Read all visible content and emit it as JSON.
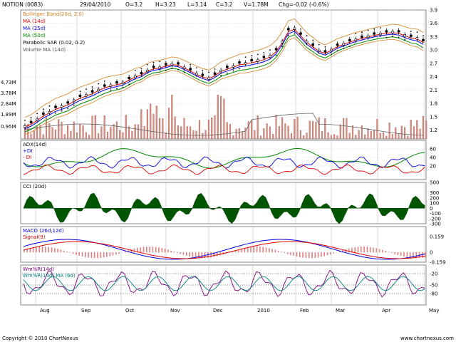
{
  "header": {
    "symbol": "NOTION (0083)",
    "date": "29/04/2010",
    "open": "O=3.2",
    "high": "H=3.23",
    "low": "L=3.14",
    "close": "C=3.2",
    "volume": "V=1.78M",
    "change": "Chg=-0.02 (-0.6%)"
  },
  "footer": {
    "copyright": "Copyright © 2010 ChartNexus",
    "site": "www.chartnexus.com"
  },
  "colors": {
    "up": "#000000",
    "bollinger": "#d08020",
    "ma14": "#dd0000",
    "ma25": "#0000dd",
    "ma50": "#008800",
    "sar": "#000000",
    "volume": "#888888",
    "grid": "#c0c0c0",
    "cci": "#005500"
  },
  "months": [
    "Aug",
    "Sep",
    "Oct",
    "Nov",
    "Dec",
    "2010",
    "Feb",
    "Mar",
    "Apr",
    "May"
  ],
  "chart_data": [
    {
      "type": "candlestick",
      "panel": "price",
      "legend": [
        "Bollinger Band(20d, 2.0)",
        "MA (14d)",
        "MA (25d)",
        "MA (50d)",
        "Parabolic SAR (0.02, 0.2)",
        "Volume MA (14d)"
      ],
      "price_ticks": [
        "3.9",
        "3.6",
        "3.3",
        "3.0",
        "2.7",
        "2.4",
        "2.1",
        "1.8",
        "1.5",
        "1.2"
      ],
      "volume_ticks": [
        "4.73M",
        "3.78M",
        "2.84M",
        "1.89M",
        "0.95M"
      ],
      "ylim": [
        1.0,
        3.9
      ],
      "x_months": [
        "Aug",
        "Sep",
        "Oct",
        "Nov",
        "Dec",
        "2010",
        "Feb",
        "Mar",
        "Apr",
        "May"
      ],
      "close": [
        1.3,
        1.36,
        1.45,
        1.55,
        1.62,
        1.7,
        1.75,
        1.8,
        1.88,
        1.95,
        2.0,
        2.05,
        2.12,
        2.18,
        2.22,
        2.25,
        2.28,
        2.35,
        2.42,
        2.46,
        2.55,
        2.6,
        2.62,
        2.66,
        2.7,
        2.68,
        2.62,
        2.55,
        2.48,
        2.42,
        2.38,
        2.45,
        2.55,
        2.6,
        2.65,
        2.7,
        2.72,
        2.75,
        2.78,
        2.82,
        2.88,
        3.0,
        3.2,
        3.45,
        3.5,
        3.35,
        3.2,
        3.1,
        3.0,
        2.95,
        3.02,
        3.1,
        3.15,
        3.2,
        3.25,
        3.28,
        3.32,
        3.35,
        3.38,
        3.4,
        3.42,
        3.4,
        3.35,
        3.3,
        3.28,
        3.2
      ]
    },
    {
      "type": "line",
      "panel": "ADX",
      "legend": [
        "ADX(14d)",
        "+DI",
        "- DI"
      ],
      "ticks": [
        "60",
        "40",
        "20"
      ],
      "ylim": [
        0,
        70
      ]
    },
    {
      "type": "area",
      "panel": "CCI",
      "legend": [
        "CCI (20d)"
      ],
      "ticks": [
        "500",
        "300",
        "200",
        "100",
        "0",
        "-100",
        "-200",
        "-300"
      ],
      "ylim": [
        -300,
        500
      ]
    },
    {
      "type": "bar",
      "panel": "MACD",
      "legend": [
        "MACD (26d,12d)",
        "Signal(9)"
      ],
      "ticks": [
        "0.159",
        "0",
        "-0.159"
      ],
      "ylim": [
        -0.2,
        0.22
      ]
    },
    {
      "type": "line",
      "panel": "Wm%R",
      "legend": [
        "Wm%R(14d)",
        "Wm%R(14d) MA (6d)"
      ],
      "ticks": [
        "-20",
        "-50",
        "-80"
      ],
      "ylim": [
        -100,
        0
      ]
    }
  ]
}
